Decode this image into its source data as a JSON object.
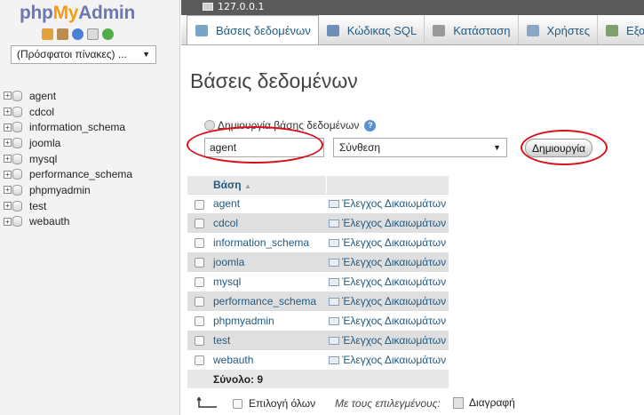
{
  "nav": {
    "logo": {
      "php": "php",
      "my": "My",
      "admin": "Admin"
    },
    "recent_select": "(Πρόσφατοι πίνακες) ...",
    "databases": [
      "agent",
      "cdcol",
      "information_schema",
      "joomla",
      "mysql",
      "performance_schema",
      "phpmyadmin",
      "test",
      "webauth"
    ]
  },
  "server": "127.0.0.1",
  "tabs": [
    {
      "label": "Βάσεις δεδομένων",
      "icon": "databases-icon",
      "active": true
    },
    {
      "label": "Κώδικας SQL",
      "icon": "sql-icon"
    },
    {
      "label": "Κατάσταση",
      "icon": "status-icon"
    },
    {
      "label": "Χρήστες",
      "icon": "users-icon"
    },
    {
      "label": "Εξαγ",
      "icon": "export-icon"
    }
  ],
  "main": {
    "title": "Βάσεις δεδομένων",
    "create": {
      "label": "Δημιουργία βάσης δεδομένων",
      "name_value": "agent",
      "collation": "Σύνθεση",
      "button": "Δημιουργία"
    },
    "table": {
      "header_db": "Βάση",
      "rows": [
        {
          "name": "agent",
          "action": "Έλεγχος Δικαιωμάτων"
        },
        {
          "name": "cdcol",
          "action": "Έλεγχος Δικαιωμάτων"
        },
        {
          "name": "information_schema",
          "action": "Έλεγχος Δικαιωμάτων"
        },
        {
          "name": "joomla",
          "action": "Έλεγχος Δικαιωμάτων"
        },
        {
          "name": "mysql",
          "action": "Έλεγχος Δικαιωμάτων"
        },
        {
          "name": "performance_schema",
          "action": "Έλεγχος Δικαιωμάτων"
        },
        {
          "name": "phpmyadmin",
          "action": "Έλεγχος Δικαιωμάτων"
        },
        {
          "name": "test",
          "action": "Έλεγχος Δικαιωμάτων"
        },
        {
          "name": "webauth",
          "action": "Έλεγχος Δικαιωμάτων"
        }
      ],
      "total": "Σύνολο: 9"
    },
    "footer": {
      "select_all": "Επιλογή όλων",
      "with_selected": "Με τους επιλεγμένους:",
      "delete": "Διαγραφή"
    }
  },
  "colors": {
    "link": "#235a81",
    "annotation": "#d8101a",
    "logo_blue": "#6c78af",
    "logo_orange": "#f89c0e"
  }
}
